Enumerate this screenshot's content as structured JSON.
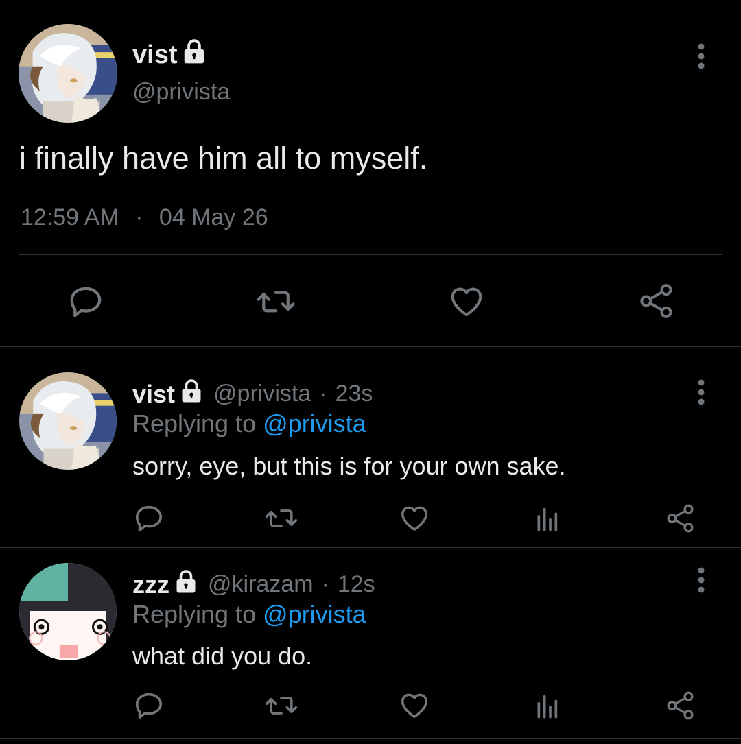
{
  "main_tweet": {
    "display_name": "vist",
    "handle": "@privista",
    "text": "i finally have him all to myself.",
    "time": "12:59 AM",
    "separator": "·",
    "date": "04 May 26",
    "avatar_icon": "anime-avatar-white-hair"
  },
  "replies": [
    {
      "display_name": "vist",
      "handle": "@privista",
      "sep": "·",
      "age": "23s",
      "replying_prefix": "Replying to",
      "replying_to": "@privista",
      "text": "sorry, eye, but this is for your own sake.",
      "avatar_icon": "anime-avatar-white-hair"
    },
    {
      "display_name": "zzz",
      "handle": "@kirazam",
      "sep": "·",
      "age": "12s",
      "replying_prefix": "Replying to",
      "replying_to": "@privista",
      "text": "what did you do.",
      "avatar_icon": "cartoon-girl-avatar"
    }
  ],
  "colors": {
    "background": "#000000",
    "text": "#e7e9ea",
    "secondary": "#71767b",
    "link": "#1d9bf0",
    "divider": "#2f3336"
  }
}
